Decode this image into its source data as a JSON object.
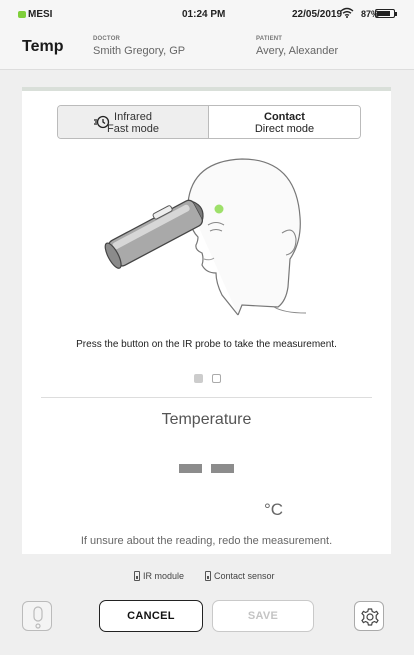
{
  "status_bar": {
    "brand": "MESI",
    "time": "01:24 PM",
    "date": "22/05/2019",
    "battery_text": "87%",
    "battery_level": 0.87,
    "wifi_icon": "wifi-icon"
  },
  "header": {
    "title": "Temp",
    "doctor_label": "DOCTOR",
    "doctor_value": "Smith Gregory, GP",
    "patient_label": "PATIENT",
    "patient_value": "Avery, Alexander"
  },
  "mode_toggle": {
    "infrared": {
      "line1": "Infrared",
      "line2": "Fast mode",
      "icon": "fast-history-icon",
      "selected": false
    },
    "contact": {
      "line1": "Contact",
      "line2": "Direct mode",
      "selected": true
    }
  },
  "illustration": {
    "icon": "forehead-thermometer-illustration"
  },
  "instruction": "Press the button on the IR probe to take the measurement.",
  "pager": {
    "total": 2,
    "active": 1
  },
  "measurement": {
    "title": "Temperature",
    "value_placeholder": "— —",
    "unit": "°C",
    "hint": "If unsure about the reading, redo the measurement."
  },
  "modules": {
    "ir_module": "IR module",
    "contact_sensor": "Contact sensor",
    "icon": "battery-icon"
  },
  "footer": {
    "info_icon": "exclamation-icon",
    "cancel": "CANCEL",
    "save": "SAVE",
    "settings_icon": "gear-icon"
  },
  "colors": {
    "accent_green": "#7fcf3a",
    "forehead_marker": "#9ee06a"
  }
}
